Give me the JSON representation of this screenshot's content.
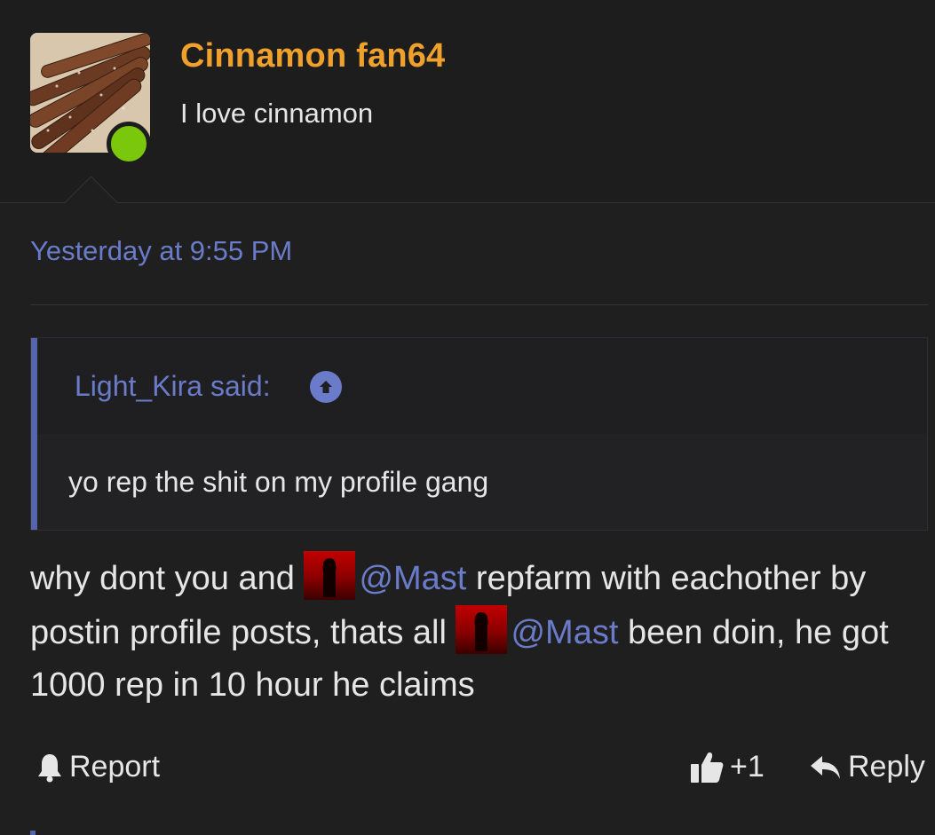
{
  "user": {
    "name": "Cinnamon fan64",
    "title": "I love cinnamon",
    "online": true
  },
  "post": {
    "date": "Yesterday at 9:55 PM"
  },
  "quote": {
    "author_label": "Light_Kira said:",
    "text": "yo rep the shit on my profile gang"
  },
  "message": {
    "part1": "why dont you and ",
    "mention1": "@Mast",
    "part2": " repfarm with eachother by postin profile posts, thats all ",
    "mention2": "@Mast",
    "part3": " been doin, he got 1000 rep in 10 hour he claims"
  },
  "actions": {
    "report": "Report",
    "like_count": "+1",
    "reply": "Reply"
  },
  "colors": {
    "username": "#f0a12c",
    "link": "#6a7cc9",
    "online": "#7ac70c",
    "background": "#1f1f20"
  },
  "icons": {
    "report": "bell-icon",
    "like": "thumbs-up-icon",
    "reply": "reply-arrow-icon",
    "jump": "arrow-up-circle-icon"
  }
}
